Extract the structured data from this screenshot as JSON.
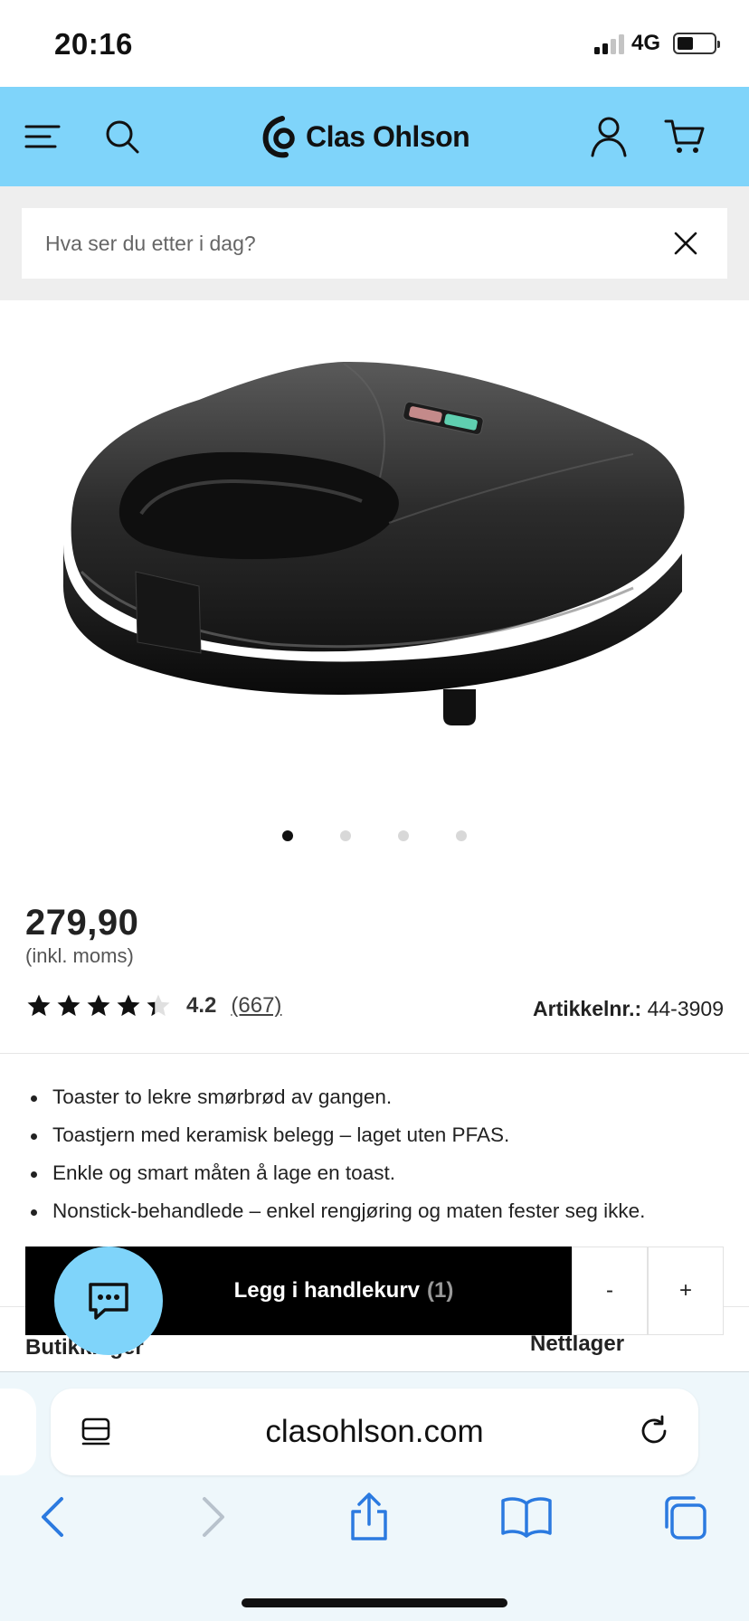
{
  "status_bar": {
    "time": "20:16",
    "network": "4G"
  },
  "header": {
    "brand": "Clas Ohlson",
    "icons": [
      "menu-icon",
      "search-icon",
      "user-icon",
      "cart-icon"
    ],
    "background_color": "#7fd4fa"
  },
  "search": {
    "placeholder": "Hva ser du etter i dag?"
  },
  "gallery": {
    "image_count": 4,
    "active_index": 0
  },
  "product": {
    "price": "279,90",
    "vat_note": "(inkl. moms)",
    "rating_value": "4.2",
    "rating_count": "(667)",
    "rating_stars": 4.2,
    "article_label": "Artikkelnr.:",
    "article_number": "44-3909",
    "bullets": [
      "Toaster to lekre smørbrød av gangen.",
      "Toastjern med keramisk belegg – laget uten PFAS.",
      "Enkle og smart måten å lage en toast.",
      "Nonstick-behandlede – enkel rengjøring og maten fester seg ikke."
    ]
  },
  "cart": {
    "add_label": "Legg i handlekurv",
    "quantity": "(1)",
    "minus": "-",
    "plus": "+"
  },
  "stock": {
    "store_label": "Butikklager",
    "online_label": "Nettlager"
  },
  "browser": {
    "url": "clasohlson.com"
  }
}
